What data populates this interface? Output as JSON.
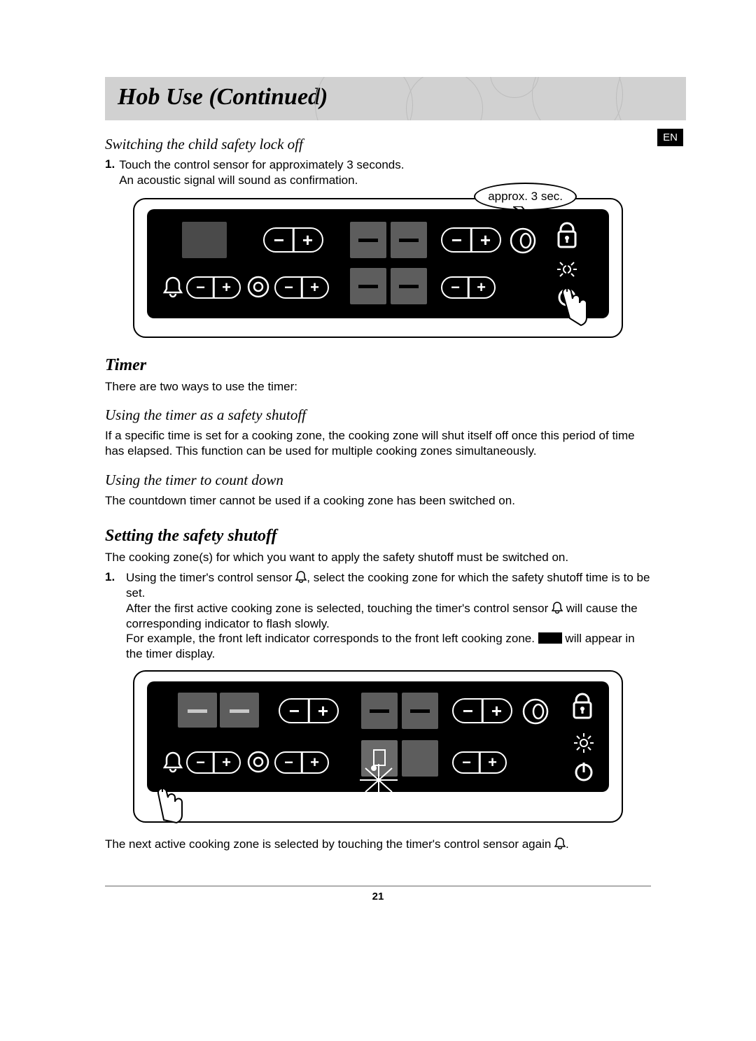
{
  "lang_tab": "EN",
  "title": "Hob Use (Continued)",
  "s1": {
    "heading": "Switching the child safety lock off",
    "step1_num": "1.",
    "step1_line1": "Touch the control sensor for approximately 3 seconds.",
    "step1_line2": "An acoustic signal will sound as confirmation.",
    "callout": "approx. 3 sec."
  },
  "timer": {
    "heading": "Timer",
    "intro": "There are two ways to use the timer:",
    "sub1_heading": "Using the timer as a safety shutoff",
    "sub1_text": "If a specific time is set for a cooking zone, the cooking zone will shut itself off once this period of time has elapsed. This function can be used for multiple cooking zones simultaneously.",
    "sub2_heading": "Using the timer to count down",
    "sub2_text": "The countdown timer cannot be used if a cooking zone has been switched on."
  },
  "shutoff": {
    "heading": "Setting the safety shutoff",
    "intro": "The cooking zone(s) for which you want to apply the safety shutoff must be switched on.",
    "step1_num": "1.",
    "step1_a": "Using the timer's control sensor ",
    "step1_b": ", select the cooking zone for which the safety shutoff time is to be set.",
    "step1_c": "After the first active cooking zone is selected, touching the timer's control sensor ",
    "step1_d": " will cause the corresponding indicator to flash slowly.",
    "step1_e": "For example, the front left indicator corresponds to the front left cooking zone. ",
    "step1_f": " will appear in the timer display.",
    "outro_a": "The next active cooking zone is selected by touching the timer's control sensor again ",
    "outro_b": "."
  },
  "page_number": "21"
}
